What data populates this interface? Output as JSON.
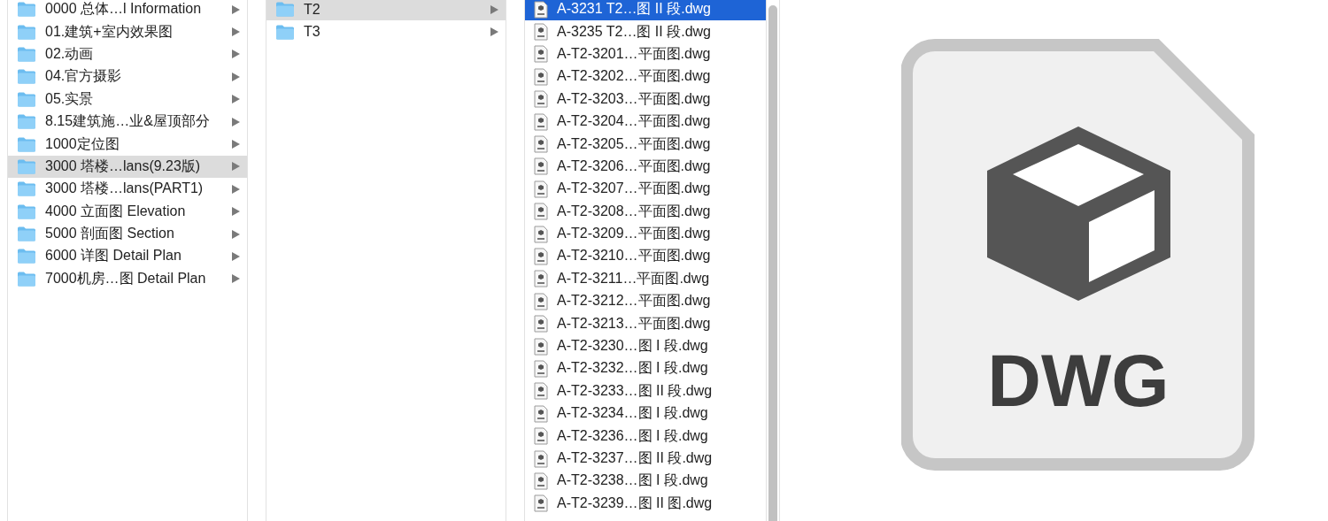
{
  "columns": [
    {
      "items": [
        {
          "kind": "folder",
          "name": "0000 总体…l Information",
          "selected": false
        },
        {
          "kind": "folder",
          "name": "01.建筑+室内效果图",
          "selected": false
        },
        {
          "kind": "folder",
          "name": "02.动画",
          "selected": false
        },
        {
          "kind": "folder",
          "name": "04.官方摄影",
          "selected": false
        },
        {
          "kind": "folder",
          "name": "05.实景",
          "selected": false
        },
        {
          "kind": "folder",
          "name": "8.15建筑施…业&屋顶部分",
          "selected": false
        },
        {
          "kind": "folder",
          "name": "1000定位图",
          "selected": false
        },
        {
          "kind": "folder",
          "name": "3000 塔楼…lans(9.23版)",
          "selected": true
        },
        {
          "kind": "folder",
          "name": "3000 塔楼…lans(PART1)",
          "selected": false
        },
        {
          "kind": "folder",
          "name": "4000 立面图 Elevation",
          "selected": false
        },
        {
          "kind": "folder",
          "name": "5000 剖面图 Section",
          "selected": false
        },
        {
          "kind": "folder",
          "name": "6000 详图 Detail Plan",
          "selected": false
        },
        {
          "kind": "folder",
          "name": "7000机房…图 Detail Plan",
          "selected": false
        }
      ]
    },
    {
      "items": [
        {
          "kind": "folder",
          "name": "T2",
          "selected": true
        },
        {
          "kind": "folder",
          "name": "T3",
          "selected": false
        }
      ]
    },
    {
      "items": [
        {
          "kind": "file",
          "name": "A-3231 T2…图 II 段.dwg",
          "selected": true
        },
        {
          "kind": "file",
          "name": "A-3235 T2…图 II 段.dwg",
          "selected": false
        },
        {
          "kind": "file",
          "name": "A-T2-3201…平面图.dwg",
          "selected": false
        },
        {
          "kind": "file",
          "name": "A-T2-3202…平面图.dwg",
          "selected": false
        },
        {
          "kind": "file",
          "name": "A-T2-3203…平面图.dwg",
          "selected": false
        },
        {
          "kind": "file",
          "name": "A-T2-3204…平面图.dwg",
          "selected": false
        },
        {
          "kind": "file",
          "name": "A-T2-3205…平面图.dwg",
          "selected": false
        },
        {
          "kind": "file",
          "name": "A-T2-3206…平面图.dwg",
          "selected": false
        },
        {
          "kind": "file",
          "name": "A-T2-3207…平面图.dwg",
          "selected": false
        },
        {
          "kind": "file",
          "name": "A-T2-3208…平面图.dwg",
          "selected": false
        },
        {
          "kind": "file",
          "name": "A-T2-3209…平面图.dwg",
          "selected": false
        },
        {
          "kind": "file",
          "name": "A-T2-3210…平面图.dwg",
          "selected": false
        },
        {
          "kind": "file",
          "name": "A-T2-3211…平面图.dwg",
          "selected": false
        },
        {
          "kind": "file",
          "name": "A-T2-3212…平面图.dwg",
          "selected": false
        },
        {
          "kind": "file",
          "name": "A-T2-3213…平面图.dwg",
          "selected": false
        },
        {
          "kind": "file",
          "name": "A-T2-3230…图 I 段.dwg",
          "selected": false
        },
        {
          "kind": "file",
          "name": "A-T2-3232…图 I 段.dwg",
          "selected": false
        },
        {
          "kind": "file",
          "name": "A-T2-3233…图 II 段.dwg",
          "selected": false
        },
        {
          "kind": "file",
          "name": "A-T2-3234…图 I 段.dwg",
          "selected": false
        },
        {
          "kind": "file",
          "name": "A-T2-3236…图 I 段.dwg",
          "selected": false
        },
        {
          "kind": "file",
          "name": "A-T2-3237…图 II 段.dwg",
          "selected": false
        },
        {
          "kind": "file",
          "name": "A-T2-3238…图 I 段.dwg",
          "selected": false
        },
        {
          "kind": "file",
          "name": "A-T2-3239…图 II 图.dwg",
          "selected": false
        }
      ]
    }
  ],
  "preview": {
    "label": "DWG"
  }
}
